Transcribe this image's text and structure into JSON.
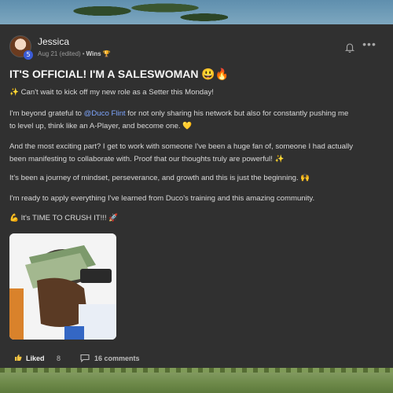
{
  "post": {
    "author": "Jessica",
    "level": "5",
    "date": "Aug 21 (edited)",
    "category": "Wins",
    "category_emoji": "🏆",
    "title": "IT'S OFFICIAL! I'M A SALESWOMAN 😃🔥",
    "para1": "✨ Can't wait to kick off my new role as a Setter this Monday!",
    "para2_before": "I'm beyond grateful to ",
    "mention": "@Duco Flint",
    "para2_line1_after": " for not only sharing his network but also for constantly pushing me",
    "para2_line2": "to level up, think like an A-Player, and become one. 💛",
    "para3_line1": "And the most exciting part? I get to work with someone I've been a huge fan of, someone I had actually",
    "para3_line2": "been manifesting to collaborate with. Proof that our thoughts truly are powerful! ✨",
    "para4": "It's been a journey of mindset, perseverance, and growth and this is just the beginning. 🙌",
    "para5": "I'm ready to apply everything I've learned from Duco's training and this amazing community.",
    "para6": "💪 It's TIME TO CRUSH IT!!! 🚀"
  },
  "footer": {
    "like_label": "Liked",
    "like_count": "8",
    "comments_label": "16 comments"
  },
  "icons": {
    "bell": "bell-icon",
    "more": "more-icon",
    "like": "thumbs-up-icon",
    "comment": "comment-icon"
  },
  "colors": {
    "card_bg": "#303030",
    "mention": "#7ea6ff",
    "level_badge": "#3b5bd6"
  }
}
